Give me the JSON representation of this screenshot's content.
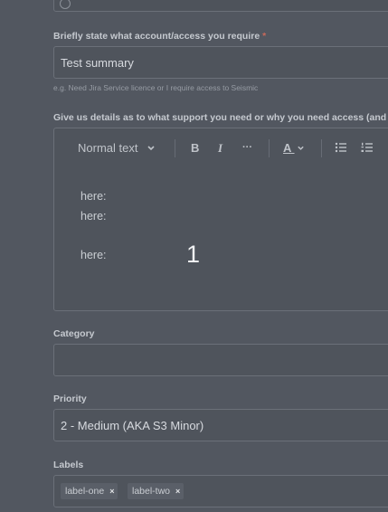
{
  "top_field": {
    "value": ""
  },
  "summary": {
    "label": "Briefly state what account/access you require",
    "required_mark": "*",
    "value": "Test summary",
    "help": "e.g. Need Jira Service licence or I require access to Seismic"
  },
  "details": {
    "label": "Give us details as to what support you need or why you need access (and f",
    "toolbar": {
      "text_style": "Normal text",
      "bold_icon": "B",
      "italic_icon": "I",
      "more_icon": "···",
      "text_color_icon": "A"
    },
    "lines": [
      "here:",
      "here:",
      "here:"
    ]
  },
  "overlay_number": "1",
  "category": {
    "label": "Category",
    "value": ""
  },
  "priority": {
    "label": "Priority",
    "value": "2 - Medium (AKA S3 Minor)"
  },
  "labels": {
    "label": "Labels",
    "tags": [
      {
        "text": "label-one",
        "remove": "×"
      },
      {
        "text": "label-two",
        "remove": "×"
      }
    ]
  }
}
